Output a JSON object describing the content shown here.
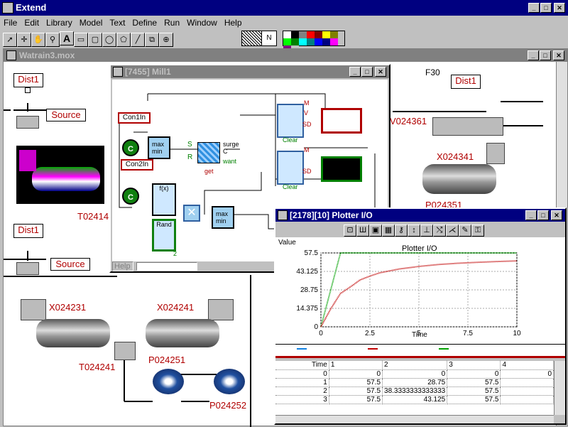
{
  "app": {
    "title": "Extend"
  },
  "menu": [
    "File",
    "Edit",
    "Library",
    "Model",
    "Text",
    "Define",
    "Run",
    "Window",
    "Help"
  ],
  "palette_colors": [
    "#ffffff",
    "#000000",
    "#808080",
    "#ff0000",
    "#800000",
    "#ffff00",
    "#808000",
    "#00ff00",
    "#008000",
    "#00ffff",
    "#008080",
    "#0000ff",
    "#000080",
    "#ff00ff",
    "#800080",
    "#c0c0c0"
  ],
  "pattern_label": "N",
  "model_window": {
    "title": "Watrain3.mox"
  },
  "model_labels": {
    "dist1_a": "Dist1",
    "dist1_b": "Dist1",
    "dist1_c": "Dist1",
    "source_a": "Source",
    "source_b": "Source",
    "f30": "F30",
    "t02414": "T02414",
    "x024231": "X024231",
    "x024241": "X024241",
    "x024341": "X024341",
    "v024361": "V024361",
    "t024241": "T024241",
    "p024251": "P024251",
    "p024252": "P024252",
    "p024351": "P024351"
  },
  "mill_window": {
    "title": "[7455]   Mill1",
    "con1": "Con1In",
    "con2": "Con2In",
    "c_label": "C",
    "maxmin": "max\nmin",
    "fx": "f(x)",
    "rand": "Rand",
    "ports": {
      "s": "S",
      "r": "R",
      "c": "C",
      "get": "get",
      "surge": "surge",
      "want": "want",
      "m": "M",
      "v": "V",
      "sd": "SD"
    },
    "clear": "Clear",
    "two": "2",
    "help_button": "Help"
  },
  "plotter_window": {
    "title": "[2178][10]  Plotter I/O",
    "value_label": "Value",
    "chart_title": "Plotter I/O",
    "x_axis_label": "Time"
  },
  "chart_data": {
    "type": "line",
    "title": "Plotter I/O",
    "xlabel": "Time",
    "ylabel": "Value",
    "xlim": [
      0,
      10
    ],
    "ylim": [
      0,
      57.5
    ],
    "x_ticks": [
      "0",
      "2.5",
      "5",
      "7.5",
      "10"
    ],
    "y_ticks": [
      "0",
      "14.375",
      "28.75",
      "43.125",
      "57.5"
    ],
    "series": [
      {
        "color": "#00a000",
        "points": [
          [
            0,
            0
          ],
          [
            0.5,
            28.75
          ],
          [
            1,
            57.5
          ],
          [
            1.3,
            57.5
          ],
          [
            10,
            57.5
          ]
        ]
      },
      {
        "color": "#c00000",
        "points": [
          [
            0,
            0
          ],
          [
            0.5,
            14
          ],
          [
            1,
            26
          ],
          [
            1.5,
            31
          ],
          [
            2,
            36.5
          ],
          [
            2.5,
            39.5
          ],
          [
            3,
            42
          ],
          [
            4,
            45
          ],
          [
            5,
            47
          ],
          [
            6,
            48.5
          ],
          [
            7,
            49.5
          ],
          [
            8,
            50.2
          ],
          [
            9,
            50.8
          ],
          [
            10,
            51.3
          ]
        ]
      }
    ]
  },
  "table": {
    "headers": [
      "Time",
      "1",
      "2",
      "3",
      "4"
    ],
    "rows": [
      [
        "0",
        "0",
        "0",
        "0",
        "0"
      ],
      [
        "1",
        "57.5",
        "28.75",
        "57.5",
        ""
      ],
      [
        "2",
        "57.5",
        "38.3333333333333",
        "57.5",
        ""
      ],
      [
        "3",
        "57.5",
        "43.125",
        "57.5",
        ""
      ]
    ]
  }
}
